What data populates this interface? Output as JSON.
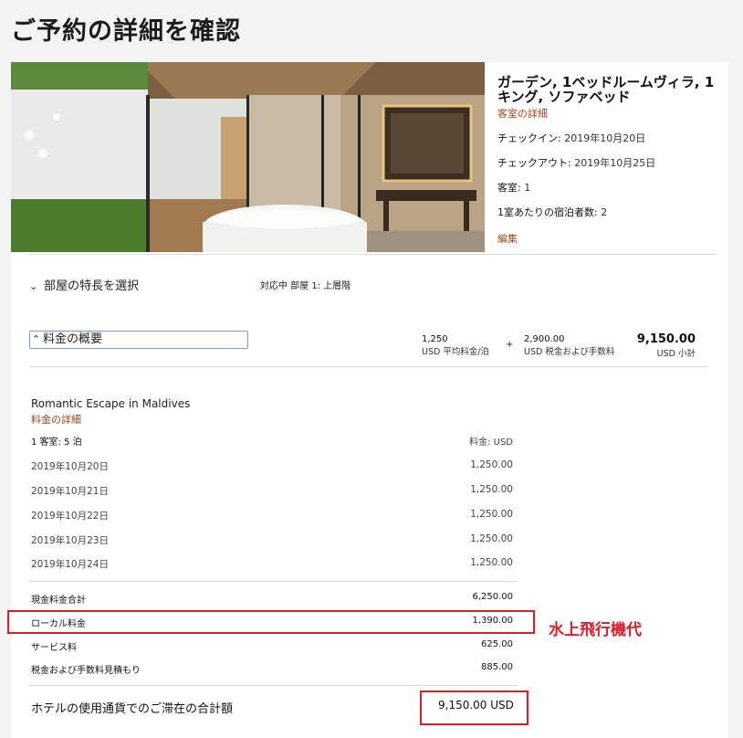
{
  "page": {
    "title": "ご予約の詳細を確認"
  },
  "room": {
    "title": "ガーデン, 1ベッドルームヴィラ, 1キング, ソファベッド",
    "details_link": "客室の詳細",
    "checkin_label": "チェックイン:",
    "checkin_value": "2019年10月2⁠0日",
    "checkout_label": "チェックアウト:",
    "checkout_value": "2019年10月2⁠5日",
    "rooms_label": "客室:",
    "rooms_value": "1",
    "guests_label": "1室あたりの宿泊者数:",
    "guests_value": "2",
    "edit_link": "編集"
  },
  "features": {
    "label": "部屋の特長を選択",
    "status": "対応中 部屋 1: 上層階"
  },
  "rate_summary": {
    "toggle_label": "料金の概要",
    "avg_value": "1,250",
    "avg_label": "USD 平均料金/泊",
    "plus": "+",
    "tax_value": "2,900.00",
    "tax_label": "USD 税金および手数料",
    "subtotal_value": "9,150.00",
    "subtotal_label": "USD 小計"
  },
  "package": {
    "name": "Romantic Escape in Maldives",
    "details_link": "料金の詳細",
    "rooms_nights": "1 客室: 5 泊",
    "currency_header": "料金: USD",
    "nights": [
      {
        "date": "2019年10月20日",
        "amount": "1,250.00"
      },
      {
        "date": "2019年10月21日",
        "amount": "1,250.00"
      },
      {
        "date": "2019年10月22日",
        "amount": "1,250.00"
      },
      {
        "date": "2019年10月23日",
        "amount": "1,250.00"
      },
      {
        "date": "2019年10月24日",
        "amount": "1,250.00"
      }
    ],
    "cash_total_label": "現金料金合計",
    "cash_total": "6,250.00",
    "local_fee_label": "ローカル料金",
    "local_fee": "1,390.00",
    "service_label": "サービス料",
    "service": "625.00",
    "tax_est_label": "税金および手数料見積もり",
    "tax_est": "885.00",
    "grand_label": "ホテルの使用通貨でのご滞在の合計額",
    "grand_total": "9,150.00 USD"
  },
  "annotation": {
    "text": "水上飛行機代"
  },
  "colors": {
    "accent_link": "#a3471c",
    "highlight": "#e01e2a",
    "focus_border": "#7b9cc9"
  }
}
